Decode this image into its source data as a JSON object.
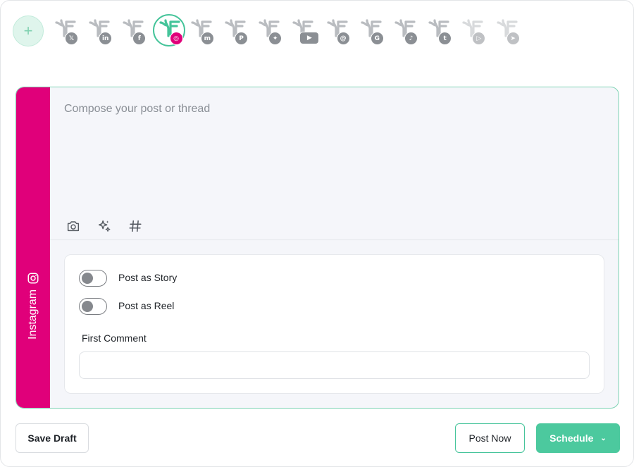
{
  "accounts": {
    "add_icon": "plus-icon",
    "items": [
      {
        "network": "x",
        "glyph": "𝕏",
        "selected": false,
        "faded": false
      },
      {
        "network": "linkedin",
        "glyph": "in",
        "selected": false,
        "faded": false
      },
      {
        "network": "facebook",
        "glyph": "f",
        "selected": false,
        "faded": false
      },
      {
        "network": "instagram",
        "glyph": "◎",
        "selected": true,
        "faded": false
      },
      {
        "network": "mastodon",
        "glyph": "m",
        "selected": false,
        "faded": false
      },
      {
        "network": "pinterest",
        "glyph": "P",
        "selected": false,
        "faded": false
      },
      {
        "network": "bluesky",
        "glyph": "✦",
        "selected": false,
        "faded": false
      },
      {
        "network": "youtube",
        "glyph": "▶",
        "selected": false,
        "faded": false
      },
      {
        "network": "threads",
        "glyph": "@",
        "selected": false,
        "faded": false
      },
      {
        "network": "google-business",
        "glyph": "G",
        "selected": false,
        "faded": false
      },
      {
        "network": "tiktok",
        "glyph": "♪",
        "selected": false,
        "faded": false
      },
      {
        "network": "tumblr",
        "glyph": "t",
        "selected": false,
        "faded": false
      },
      {
        "network": "video",
        "glyph": "▷",
        "selected": false,
        "faded": true
      },
      {
        "network": "telegram",
        "glyph": "➤",
        "selected": false,
        "faded": true
      }
    ]
  },
  "editor": {
    "network_label": "Instagram",
    "placeholder": "Compose your post or thread",
    "value": "",
    "tools": [
      "camera-icon",
      "ai-sparkle-icon",
      "hashtag-icon"
    ]
  },
  "options": {
    "story_label": "Post as Story",
    "story_on": false,
    "reel_label": "Post as Reel",
    "reel_on": false,
    "first_comment_label": "First Comment",
    "first_comment_value": ""
  },
  "footer": {
    "save_draft": "Save Draft",
    "post_now": "Post Now",
    "schedule": "Schedule"
  },
  "colors": {
    "accent": "#4cc99e",
    "instagram": "#e0007a"
  }
}
